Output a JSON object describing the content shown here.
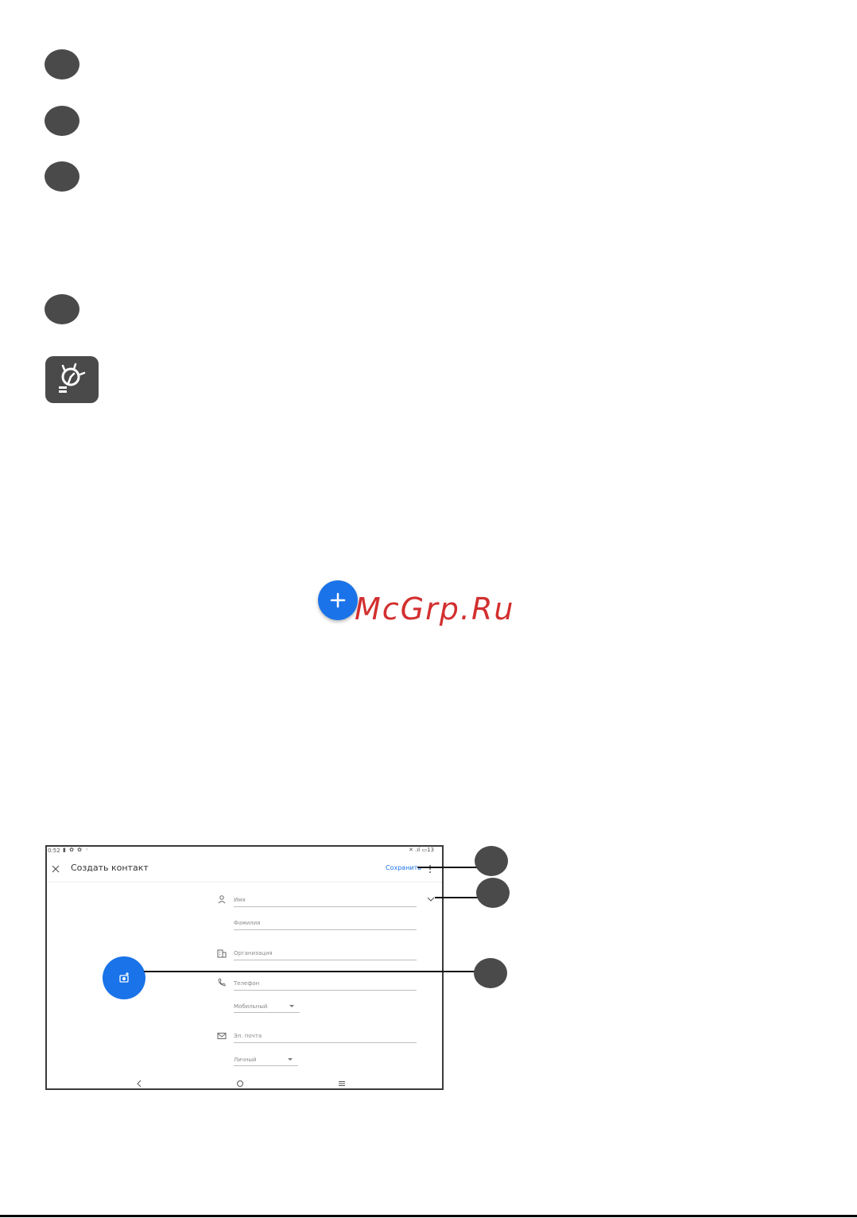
{
  "watermark": {
    "text": "McGrp.Ru",
    "color": "#d32f2f"
  },
  "accent_color": "#1a73e8",
  "icons": {
    "tip": "lightbulb-icon",
    "add": "plus-icon",
    "photo": "add-photo-icon"
  },
  "screen": {
    "status": {
      "time": "0:52",
      "battery": "13"
    },
    "title": "Создать контакт",
    "save_label": "Сохранить",
    "fields": {
      "first_name": "Имя",
      "last_name": "Фамилия",
      "company": "Организация",
      "phone": "Телефон",
      "phone_type": "Мобильный",
      "email": "Эл. почта",
      "email_type": "Личный"
    }
  }
}
